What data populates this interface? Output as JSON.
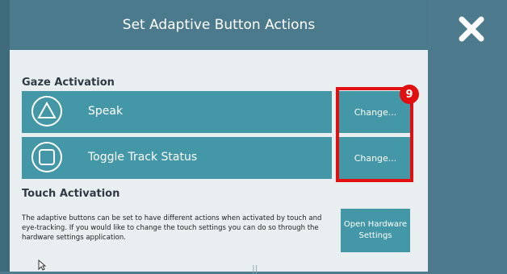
{
  "dialog": {
    "title": "Set Adaptive Button Actions",
    "close_icon": "close-icon"
  },
  "gaze": {
    "title": "Gaze Activation",
    "rows": [
      {
        "label": "Speak",
        "icon": "triangle-icon",
        "change_label": "Change..."
      },
      {
        "label": "Toggle Track Status",
        "icon": "square-icon",
        "change_label": "Change..."
      }
    ]
  },
  "touch": {
    "title": "Touch Activation",
    "description": "The adaptive buttons can be set to have different actions when activated by touch and eye-tracking. If you would like to change the touch settings you can do so through the hardware settings application.",
    "hardware_button_label": "Open Hardware Settings"
  },
  "annotation": {
    "badge": "9",
    "color": "#e01010"
  },
  "colors": {
    "header": "#4b7a8c",
    "button": "#4397a7",
    "panel": "#e9eef0"
  }
}
